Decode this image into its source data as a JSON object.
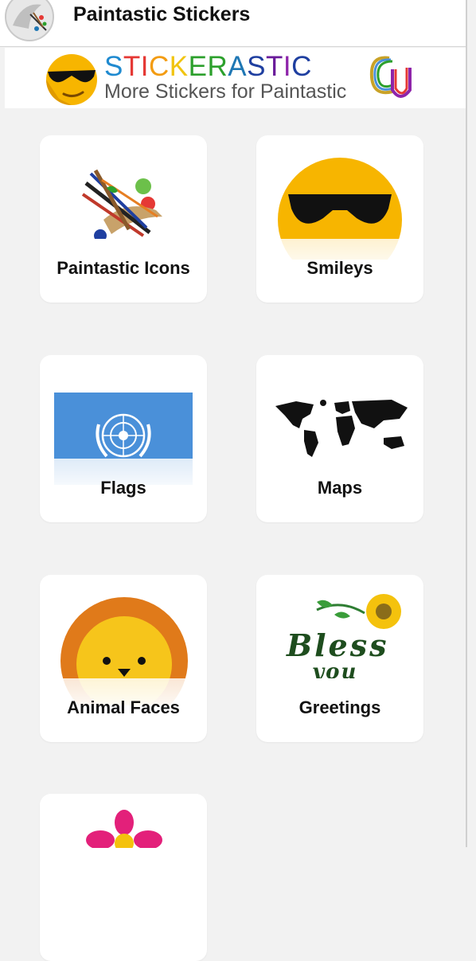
{
  "app": {
    "title": "Paintastic Stickers"
  },
  "banner": {
    "title_letters": [
      "S",
      "T",
      "I",
      "C",
      "K",
      "E",
      "R",
      "A",
      "S",
      "T",
      "I",
      "C"
    ],
    "title_colors": [
      "#1f8ad0",
      "#e53935",
      "#e53935",
      "#f39c12",
      "#f1c40f",
      "#2ca02c",
      "#2ca02c",
      "#1f77b4",
      "#1f3fa0",
      "#6a1b9a",
      "#8e24aa",
      "#1f3fa0"
    ],
    "subtitle": "More Stickers for Paintastic"
  },
  "categories": [
    {
      "label": "Paintastic Icons",
      "icon": "paint-brushes-icon"
    },
    {
      "label": "Smileys",
      "icon": "sunglasses-smiley-icon"
    },
    {
      "label": "Flags",
      "icon": "un-flag-icon"
    },
    {
      "label": "Maps",
      "icon": "world-map-icon"
    },
    {
      "label": "Animal Faces",
      "icon": "lion-face-icon"
    },
    {
      "label": "Greetings",
      "icon": "bless-you-sunflower-icon"
    },
    {
      "label": "",
      "icon": "pink-flower-icon"
    }
  ],
  "greeting_text": {
    "line1": "Bless",
    "line2": "you"
  },
  "colors": {
    "background": "#f2f2f2",
    "smiley_yellow": "#f7b500",
    "flag_blue": "#4a90d9",
    "lion_mane": "#e07a1a",
    "lion_face": "#f6c51b",
    "flower_pink": "#e3207a"
  }
}
